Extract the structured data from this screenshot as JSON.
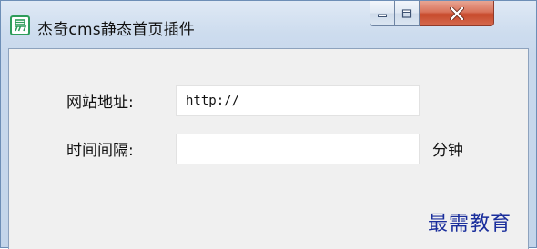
{
  "window": {
    "title": "杰奇cms静态首页插件",
    "icon": "app-logo-icon",
    "controls": {
      "minimize": "minimize-icon",
      "maximize": "maximize-icon",
      "close": "close-icon"
    }
  },
  "form": {
    "site_url_label": "网站地址:",
    "site_url_value": "http://",
    "interval_label": "时间间隔:",
    "interval_value": "",
    "interval_unit": "分钟"
  },
  "watermark": "最需教育",
  "colors": {
    "title_bar": "#cddcee",
    "client_bg": "#f0f0f0",
    "close_button": "#c74a2c",
    "app_icon": "#2e9c5a",
    "watermark": "#1a2e9c"
  }
}
